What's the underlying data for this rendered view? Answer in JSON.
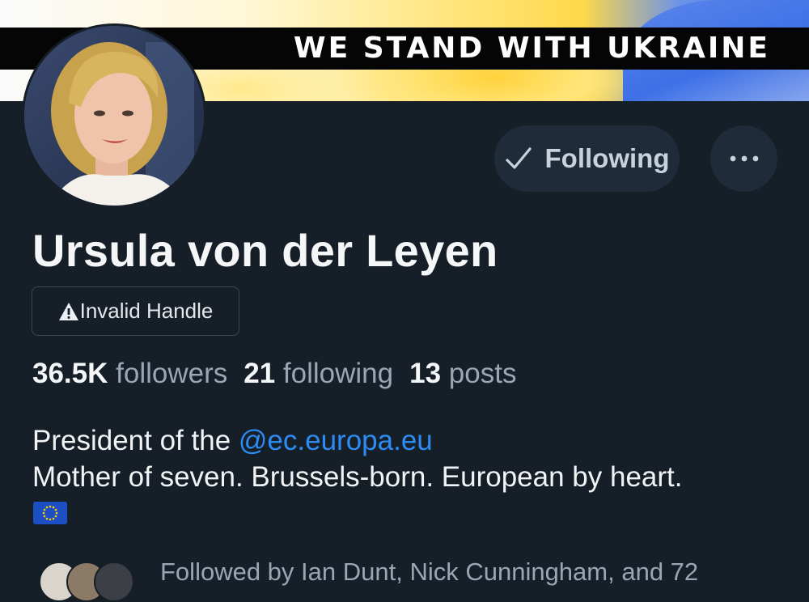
{
  "banner": {
    "text": "WE STAND WITH UKRAINE"
  },
  "profile": {
    "display_name": "Ursula von der Leyen",
    "handle_badge": "Invalid Handle",
    "follow_button_label": "Following",
    "stats": {
      "followers_count": "36.5K",
      "followers_label": "followers",
      "following_count": "21",
      "following_label": "following",
      "posts_count": "13",
      "posts_label": "posts"
    },
    "bio": {
      "line1_prefix": "President of the ",
      "line1_mention": "@ec.europa.eu",
      "line2": "Mother of seven. Brussels-born. European by heart.",
      "flag_emoji": "🇪🇺"
    },
    "followed_by_text": "Followed by Ian Dunt, Nick Cunningham, and 72"
  },
  "icons": {
    "check": "check-icon",
    "more": "more-options-icon",
    "warning": "warning-icon",
    "flag": "eu-flag-icon"
  },
  "colors": {
    "background": "#161e27",
    "button_bg": "#1f2b38",
    "mention": "#2c8cf4",
    "muted_text": "#9aa6b3"
  }
}
